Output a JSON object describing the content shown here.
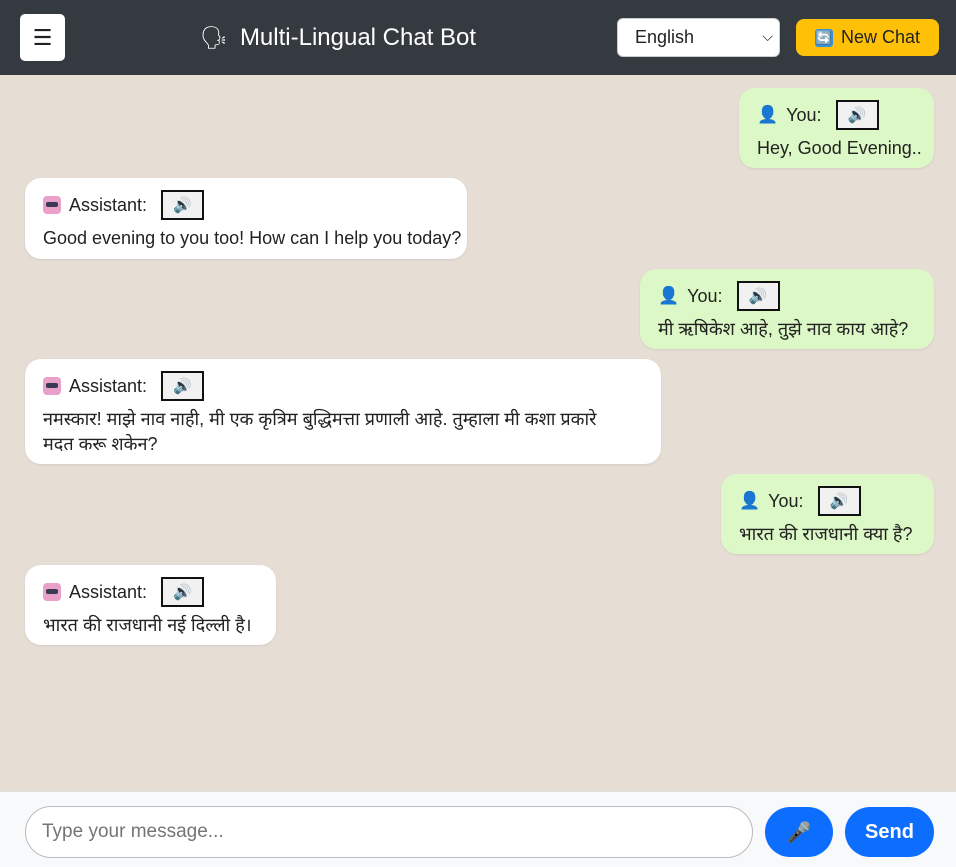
{
  "header": {
    "menu_icon": "☰",
    "title_icon": "🗣",
    "title": "Multi-Lingual Chat Bot",
    "language": "English",
    "new_chat_icon": "🔄",
    "new_chat_label": "New Chat"
  },
  "icons": {
    "speaker": "🔊",
    "user": "👤",
    "mic": "🎤"
  },
  "messages": [
    {
      "role": "You:",
      "text": "Hey, Good Evening.."
    },
    {
      "role": "Assistant:",
      "text": "Good evening to you too! How can I help you today?"
    },
    {
      "role": "You:",
      "text": "मी ऋषिकेश आहे, तुझे नाव काय आहे?"
    },
    {
      "role": "Assistant:",
      "text": "नमस्कार! माझे नाव नाही, मी एक कृत्रिम बुद्धिमत्ता प्रणाली आहे. तुम्हाला मी कशा प्रकारे",
      "text2": "मदत करू शकेन?"
    },
    {
      "role": "You:",
      "text": "भारत की राजधानी क्या है?"
    },
    {
      "role": "Assistant:",
      "text": "भारत की राजधानी नई दिल्ली है।"
    }
  ],
  "footer": {
    "placeholder": "Type your message...",
    "send_label": "Send"
  }
}
